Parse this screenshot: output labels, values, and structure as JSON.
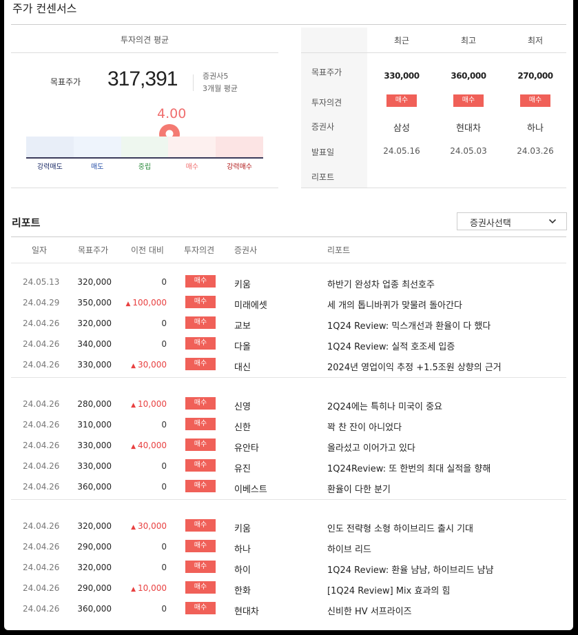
{
  "section_title": "주가 컨센서스",
  "consensus": {
    "header": "투자의견 평균",
    "target_label": "목표주가",
    "target_value": "317,391",
    "meta_firms": "증권사5",
    "meta_period": "3개월 평균",
    "score": "4.00",
    "score_value": 4.0,
    "gauge_labels": [
      {
        "label": "강력매도",
        "color": "#1a2a66"
      },
      {
        "label": "매도",
        "color": "#2850a8"
      },
      {
        "label": "중립",
        "color": "#2c8a3c"
      },
      {
        "label": "매수",
        "color": "#f06e6e"
      },
      {
        "label": "강력매수",
        "color": "#b01818"
      }
    ],
    "gauge_colors": [
      "#e8eef8",
      "#eef4fc",
      "#eef7ef",
      "#fdf0ef",
      "#fce4e4"
    ]
  },
  "summary": {
    "columns": [
      "최근",
      "최고",
      "최저"
    ],
    "row_labels": [
      "목표주가",
      "투자의견",
      "증권사",
      "발표일",
      "리포트"
    ],
    "prices": [
      "330,000",
      "360,000",
      "270,000"
    ],
    "opinions": [
      "매수",
      "매수",
      "매수"
    ],
    "firms": [
      "삼성",
      "현대차",
      "하나"
    ],
    "dates": [
      "24.05.16",
      "24.05.03",
      "24.03.26"
    ]
  },
  "reports": {
    "title": "리포트",
    "select_label": "증권사선택",
    "headers": [
      "일자",
      "목표주가",
      "이전 대비",
      "투자의견",
      "증권사",
      "리포트"
    ],
    "rows": [
      {
        "date": "24.05.13",
        "price": "320,000",
        "diff": "0",
        "up": false,
        "opinion": "매수",
        "firm": "키움",
        "report": "하반기 완성차 업종 최선호주"
      },
      {
        "date": "24.04.29",
        "price": "350,000",
        "diff": "100,000",
        "up": true,
        "opinion": "매수",
        "firm": "미래에셋",
        "report": "세 개의 톱니바퀴가 맞물려 돌아간다"
      },
      {
        "date": "24.04.26",
        "price": "320,000",
        "diff": "0",
        "up": false,
        "opinion": "매수",
        "firm": "교보",
        "report": "1Q24 Review: 믹스개선과 환율이 다 했다"
      },
      {
        "date": "24.04.26",
        "price": "340,000",
        "diff": "0",
        "up": false,
        "opinion": "매수",
        "firm": "다올",
        "report": "1Q24 Review: 실적 호조세 입증"
      },
      {
        "date": "24.04.26",
        "price": "330,000",
        "diff": "30,000",
        "up": true,
        "opinion": "매수",
        "firm": "대신",
        "report": "2024년 영업이익 추정 +1.5조원 상향의 근거"
      },
      {
        "date": "24.04.26",
        "price": "280,000",
        "diff": "10,000",
        "up": true,
        "opinion": "매수",
        "firm": "신영",
        "report": "2Q24에는 특히나 미국이 중요"
      },
      {
        "date": "24.04.26",
        "price": "310,000",
        "diff": "0",
        "up": false,
        "opinion": "매수",
        "firm": "신한",
        "report": "꽉 찬 잔이 아니었다"
      },
      {
        "date": "24.04.26",
        "price": "330,000",
        "diff": "40,000",
        "up": true,
        "opinion": "매수",
        "firm": "유안타",
        "report": "올라섰고 이어가고 있다"
      },
      {
        "date": "24.04.26",
        "price": "330,000",
        "diff": "0",
        "up": false,
        "opinion": "매수",
        "firm": "유진",
        "report": "1Q24Review: 또 한번의 최대 실적을 향해"
      },
      {
        "date": "24.04.26",
        "price": "360,000",
        "diff": "0",
        "up": false,
        "opinion": "매수",
        "firm": "이베스트",
        "report": "환율이 다한 분기"
      },
      {
        "date": "24.04.26",
        "price": "320,000",
        "diff": "30,000",
        "up": true,
        "opinion": "매수",
        "firm": "키움",
        "report": "인도 전략형 소형 하이브리드 출시 기대"
      },
      {
        "date": "24.04.26",
        "price": "290,000",
        "diff": "0",
        "up": false,
        "opinion": "매수",
        "firm": "하나",
        "report": "하이브 리드"
      },
      {
        "date": "24.04.26",
        "price": "320,000",
        "diff": "0",
        "up": false,
        "opinion": "매수",
        "firm": "하이",
        "report": "1Q24 Review: 환율 냠냠, 하이브리드 냠냠"
      },
      {
        "date": "24.04.26",
        "price": "290,000",
        "diff": "10,000",
        "up": true,
        "opinion": "매수",
        "firm": "한화",
        "report": "[1Q24 Review] Mix 효과의 힘"
      },
      {
        "date": "24.04.26",
        "price": "360,000",
        "diff": "0",
        "up": false,
        "opinion": "매수",
        "firm": "현대차",
        "report": "신비한 HV 서프라이즈"
      }
    ]
  }
}
